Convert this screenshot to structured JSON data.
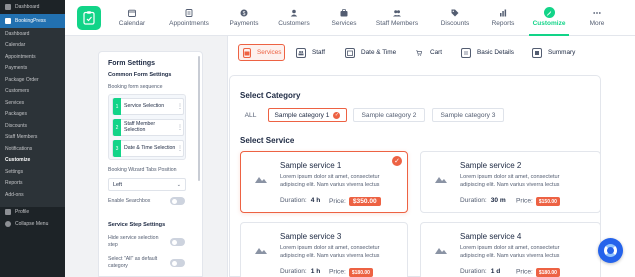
{
  "wp_sidebar": {
    "dashboard": "Dashboard",
    "plugin": "BookingPress",
    "submenu": [
      "Dashboard",
      "Calendar",
      "Appointments",
      "Payments",
      "Package Order",
      "Customers",
      "Services",
      "Packages",
      "Discounts",
      "Staff Members",
      "Notifications",
      "Customize",
      "Settings",
      "Reports",
      "Add-ons"
    ],
    "current": "Customize",
    "profile": "Profile",
    "collapse": "Collapse Menu"
  },
  "topnav": {
    "items": [
      {
        "label": "Calendar",
        "icon": "calendar-icon"
      },
      {
        "label": "Appointments",
        "icon": "appointments-icon"
      },
      {
        "label": "Payments",
        "icon": "payments-icon"
      },
      {
        "label": "Customers",
        "icon": "customers-icon"
      },
      {
        "label": "Services",
        "icon": "services-icon"
      },
      {
        "label": "Staff Members",
        "icon": "staff-icon"
      },
      {
        "label": "Discounts",
        "icon": "discounts-icon"
      },
      {
        "label": "Reports",
        "icon": "reports-icon"
      },
      {
        "label": "Customize",
        "icon": "customize-icon"
      },
      {
        "label": "More",
        "icon": "more-icon"
      }
    ],
    "active": "Customize"
  },
  "form_settings": {
    "title": "Form Settings",
    "common_heading": "Common Form Settings",
    "sequence_label": "Booking form sequence",
    "sequence": [
      {
        "num": "1",
        "label": "Service Selection"
      },
      {
        "num": "2",
        "label": "Staff Member Selection"
      },
      {
        "num": "3",
        "label": "Date & Time Selection"
      }
    ],
    "tabs_position_label": "Booking Wizard Tabs Position",
    "tabs_position_value": "Left",
    "enable_searchbox": "Enable Searchbox",
    "step_heading": "Service Step Settings",
    "hide_service_step": "Hide service selection step",
    "select_all_default": "Select \"All\" as default category"
  },
  "steps": {
    "items": [
      "Services",
      "Staff",
      "Date & Time",
      "Cart",
      "Basic Details",
      "Summary"
    ],
    "active": "Services"
  },
  "category": {
    "heading": "Select Category",
    "chips": [
      "ALL",
      "Sample category 1",
      "Sample category 2",
      "Sample category 3"
    ],
    "active": "Sample category 1"
  },
  "services": {
    "heading": "Select Service",
    "duration_label": "Duration:",
    "price_label": "Price:",
    "items": [
      {
        "name": "Sample service 1",
        "desc": "Lorem ipsum dolor sit amet, consectetur adipiscing elit. Nam varius viverra lectus",
        "duration": "4 h",
        "price": "$350.00",
        "selected": true
      },
      {
        "name": "Sample service 2",
        "desc": "Lorem ipsum dolor sit amet, consectetur adipiscing elit. Nam varius viverra lectus",
        "duration": "30 m",
        "price": "$150.00",
        "selected": false
      },
      {
        "name": "Sample service 3",
        "desc": "Lorem ipsum dolor sit amet, consectetur adipiscing elit. Nam varius viverra lectus",
        "duration": "1 h",
        "price": "$180.00",
        "selected": false
      },
      {
        "name": "Sample service 4",
        "desc": "Lorem ipsum dolor sit amet, consectetur adipiscing elit. Nam varius viverra lectus",
        "duration": "1 d",
        "price": "$180.00",
        "selected": false
      }
    ]
  },
  "colors": {
    "accent": "#ed6243",
    "brand": "#12d488",
    "wp_admin": "#1d2327",
    "wp_active": "#2271b1",
    "help": "#2563eb"
  },
  "help_button": {
    "icon": "lifebuoy-icon"
  }
}
